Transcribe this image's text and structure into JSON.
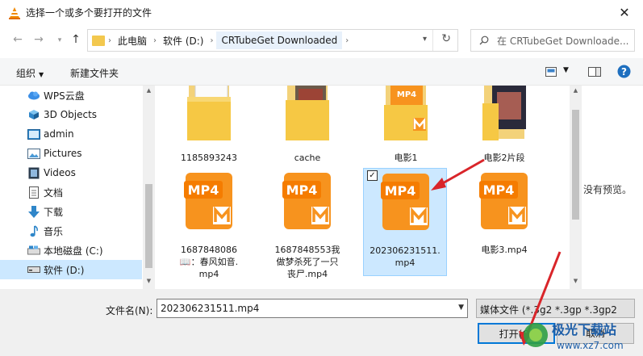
{
  "window": {
    "title": "选择一个或多个要打开的文件"
  },
  "address": {
    "crumbs": [
      "此电脑",
      "软件 (D:)",
      "CRTubeGet Downloaded"
    ]
  },
  "search": {
    "placeholder": "在 CRTubeGet Downloade..."
  },
  "toolbar": {
    "organize_label": "组织",
    "new_folder_label": "新建文件夹"
  },
  "sidebar": {
    "items": [
      {
        "label": "WPS云盘",
        "icon": "cloud-icon"
      },
      {
        "label": "3D Objects",
        "icon": "cube-icon"
      },
      {
        "label": "admin",
        "icon": "user-folder-icon"
      },
      {
        "label": "Pictures",
        "icon": "pictures-icon"
      },
      {
        "label": "Videos",
        "icon": "video-icon"
      },
      {
        "label": "文档",
        "icon": "document-icon"
      },
      {
        "label": "下载",
        "icon": "download-icon"
      },
      {
        "label": "音乐",
        "icon": "music-icon"
      },
      {
        "label": "本地磁盘 (C:)",
        "icon": "drive-icon"
      },
      {
        "label": "软件 (D:)",
        "icon": "drive-icon"
      }
    ]
  },
  "files": [
    {
      "name": "1185893243",
      "type": "folder"
    },
    {
      "name": "cache",
      "type": "folder"
    },
    {
      "name": "电影1",
      "type": "folder"
    },
    {
      "name": "电影2片段",
      "type": "folder"
    },
    {
      "name": "1687848086\n📖：春风如音.\nmp4",
      "type": "mp4"
    },
    {
      "name": "1687848553我\n做梦杀死了一只\n丧尸.mp4",
      "type": "mp4"
    },
    {
      "name": "202306231511.\nmp4",
      "type": "mp4"
    },
    {
      "name": "电影3.mp4",
      "type": "mp4"
    }
  ],
  "mp4_badge": "MP4",
  "preview": {
    "message": "没有预览。"
  },
  "bottom": {
    "filename_label": "文件名(N):",
    "filename_value": "202306231511.mp4",
    "filter_value": "媒体文件 (*.3g2 *.3gp *.3gp2",
    "open_label": "打开(O)",
    "cancel_label": "取消"
  },
  "watermark": {
    "brand": "极光下载站",
    "url": "www.xz7.com"
  },
  "colors": {
    "selection": "#cce8ff",
    "accent": "#0078d7",
    "mp4_orange": "#f7931e",
    "folder_yellow": "#f3c84e",
    "arrow_red": "#d9252a"
  }
}
